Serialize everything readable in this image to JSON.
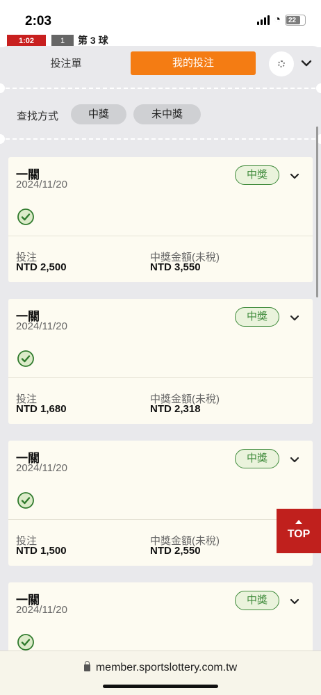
{
  "status_bar": {
    "time": "2:03",
    "battery": "22"
  },
  "background_page": {
    "red_badge": "1:02",
    "grey_badge": "1",
    "label": "第 3 球"
  },
  "tabs": {
    "bet_slip": "投注單",
    "my_bets": "我的投注",
    "active_color": "#f47c13"
  },
  "filter": {
    "label": "查找方式",
    "options": [
      "中獎",
      "未中獎"
    ]
  },
  "cards": [
    {
      "type": "一關",
      "date": "2024/11/20",
      "result": "中獎",
      "stake_label": "投注",
      "stake": "NTD 2,500",
      "win_label": "中獎金額(未稅)",
      "win_amount": "NTD 3,550"
    },
    {
      "type": "一關",
      "date": "2024/11/20",
      "result": "中獎",
      "stake_label": "投注",
      "stake": "NTD 1,680",
      "win_label": "中獎金額(未稅)",
      "win_amount": "NTD 2,318"
    },
    {
      "type": "一關",
      "date": "2024/11/20",
      "result": "中獎",
      "stake_label": "投注",
      "stake": "NTD 1,500",
      "win_label": "中獎金額(未稅)",
      "win_amount": "NTD 2,550"
    },
    {
      "type": "一關",
      "date": "2024/11/20",
      "result": "中獎"
    }
  ],
  "top_button": {
    "label": "TOP",
    "color": "#c0201d"
  },
  "browser": {
    "url": "member.sportslottery.com.tw"
  },
  "icons": {
    "settings": "gear-icon",
    "collapse": "chevron-down-icon",
    "expand": "chevron-down-icon",
    "success": "check-circle-icon",
    "secure": "lock-icon"
  }
}
